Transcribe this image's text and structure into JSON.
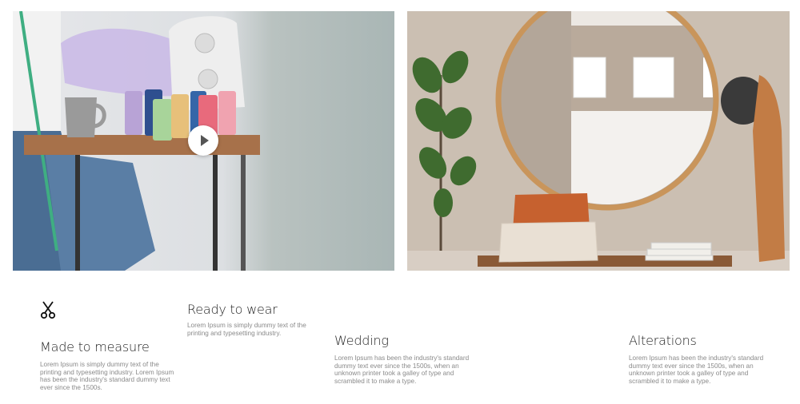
{
  "hero": {
    "left_image": {
      "subject": "sewing-workspace-photo",
      "play_icon": "play-icon"
    },
    "right_image": {
      "subject": "entryway-mirror-photo"
    }
  },
  "features": {
    "measure": {
      "icon": "scissors-icon",
      "title": "Made to measure",
      "desc": "Lorem Ipsum is simply dummy text of the printing and typesetting industry. Lorem Ipsum has been the industry's standard dummy text ever since the 1500s."
    },
    "ready": {
      "title": "Ready to wear",
      "desc": "Lorem Ipsum is simply dummy text of the printing and typesetting industry."
    },
    "wedding": {
      "title": "Wedding",
      "desc": "Lorem Ipsum has been the industry's standard dummy text ever since the 1500s, when an unknown printer took a galley of type and scrambled it to make a type."
    },
    "alterations": {
      "title": "Alterations",
      "desc": "Lorem Ipsum has been the industry's standard dummy text ever since the 1500s, when an unknown printer took a galley of type and scrambled it to make a type."
    }
  }
}
